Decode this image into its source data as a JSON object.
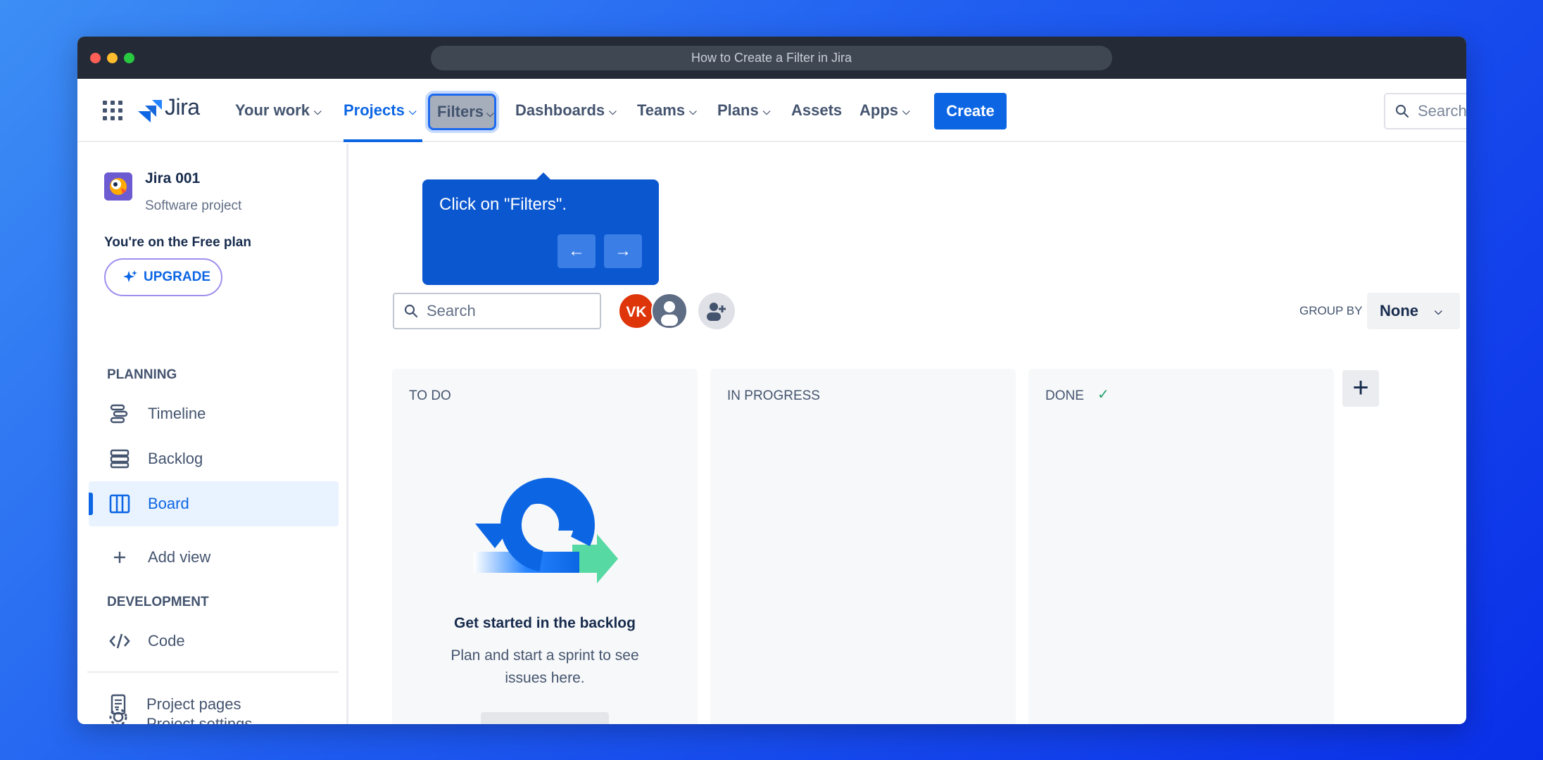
{
  "window": {
    "title": "How to Create a Filter in Jira"
  },
  "nav": {
    "brand": "Jira",
    "items": [
      {
        "label": "Your work"
      },
      {
        "label": "Projects"
      },
      {
        "label": "Filters"
      },
      {
        "label": "Dashboards"
      },
      {
        "label": "Teams"
      },
      {
        "label": "Plans"
      },
      {
        "label": "Assets"
      },
      {
        "label": "Apps"
      }
    ],
    "create_label": "Create",
    "search_placeholder": "Search"
  },
  "sidebar": {
    "project_name": "Jira 001",
    "project_type": "Software project",
    "plan_text": "You're on the Free plan",
    "upgrade_label": "UPGRADE",
    "planning_title": "PLANNING",
    "planning_items": [
      {
        "label": "Timeline"
      },
      {
        "label": "Backlog"
      },
      {
        "label": "Board"
      }
    ],
    "add_view_label": "Add view",
    "development_title": "DEVELOPMENT",
    "code_label": "Code",
    "project_pages_label": "Project pages",
    "project_settings_label": "Project settings"
  },
  "tooltip": {
    "text": "Click on \"Filters\".",
    "prev_glyph": "←",
    "next_glyph": "→"
  },
  "board": {
    "search_placeholder": "Search",
    "avatar_initials": "VK",
    "group_by_label": "GROUP BY",
    "group_by_value": "None",
    "columns": [
      {
        "title": "TO DO"
      },
      {
        "title": "IN PROGRESS"
      },
      {
        "title": "DONE"
      }
    ],
    "add_column_glyph": "+",
    "empty_title": "Get started in the backlog",
    "empty_desc": "Plan and start a sprint to see issues here."
  },
  "colors": {
    "accent": "#0c66e4",
    "tooltip_bg": "#0b57d0",
    "avatar_vk": "#de350b",
    "done_check": "#22a06b"
  }
}
